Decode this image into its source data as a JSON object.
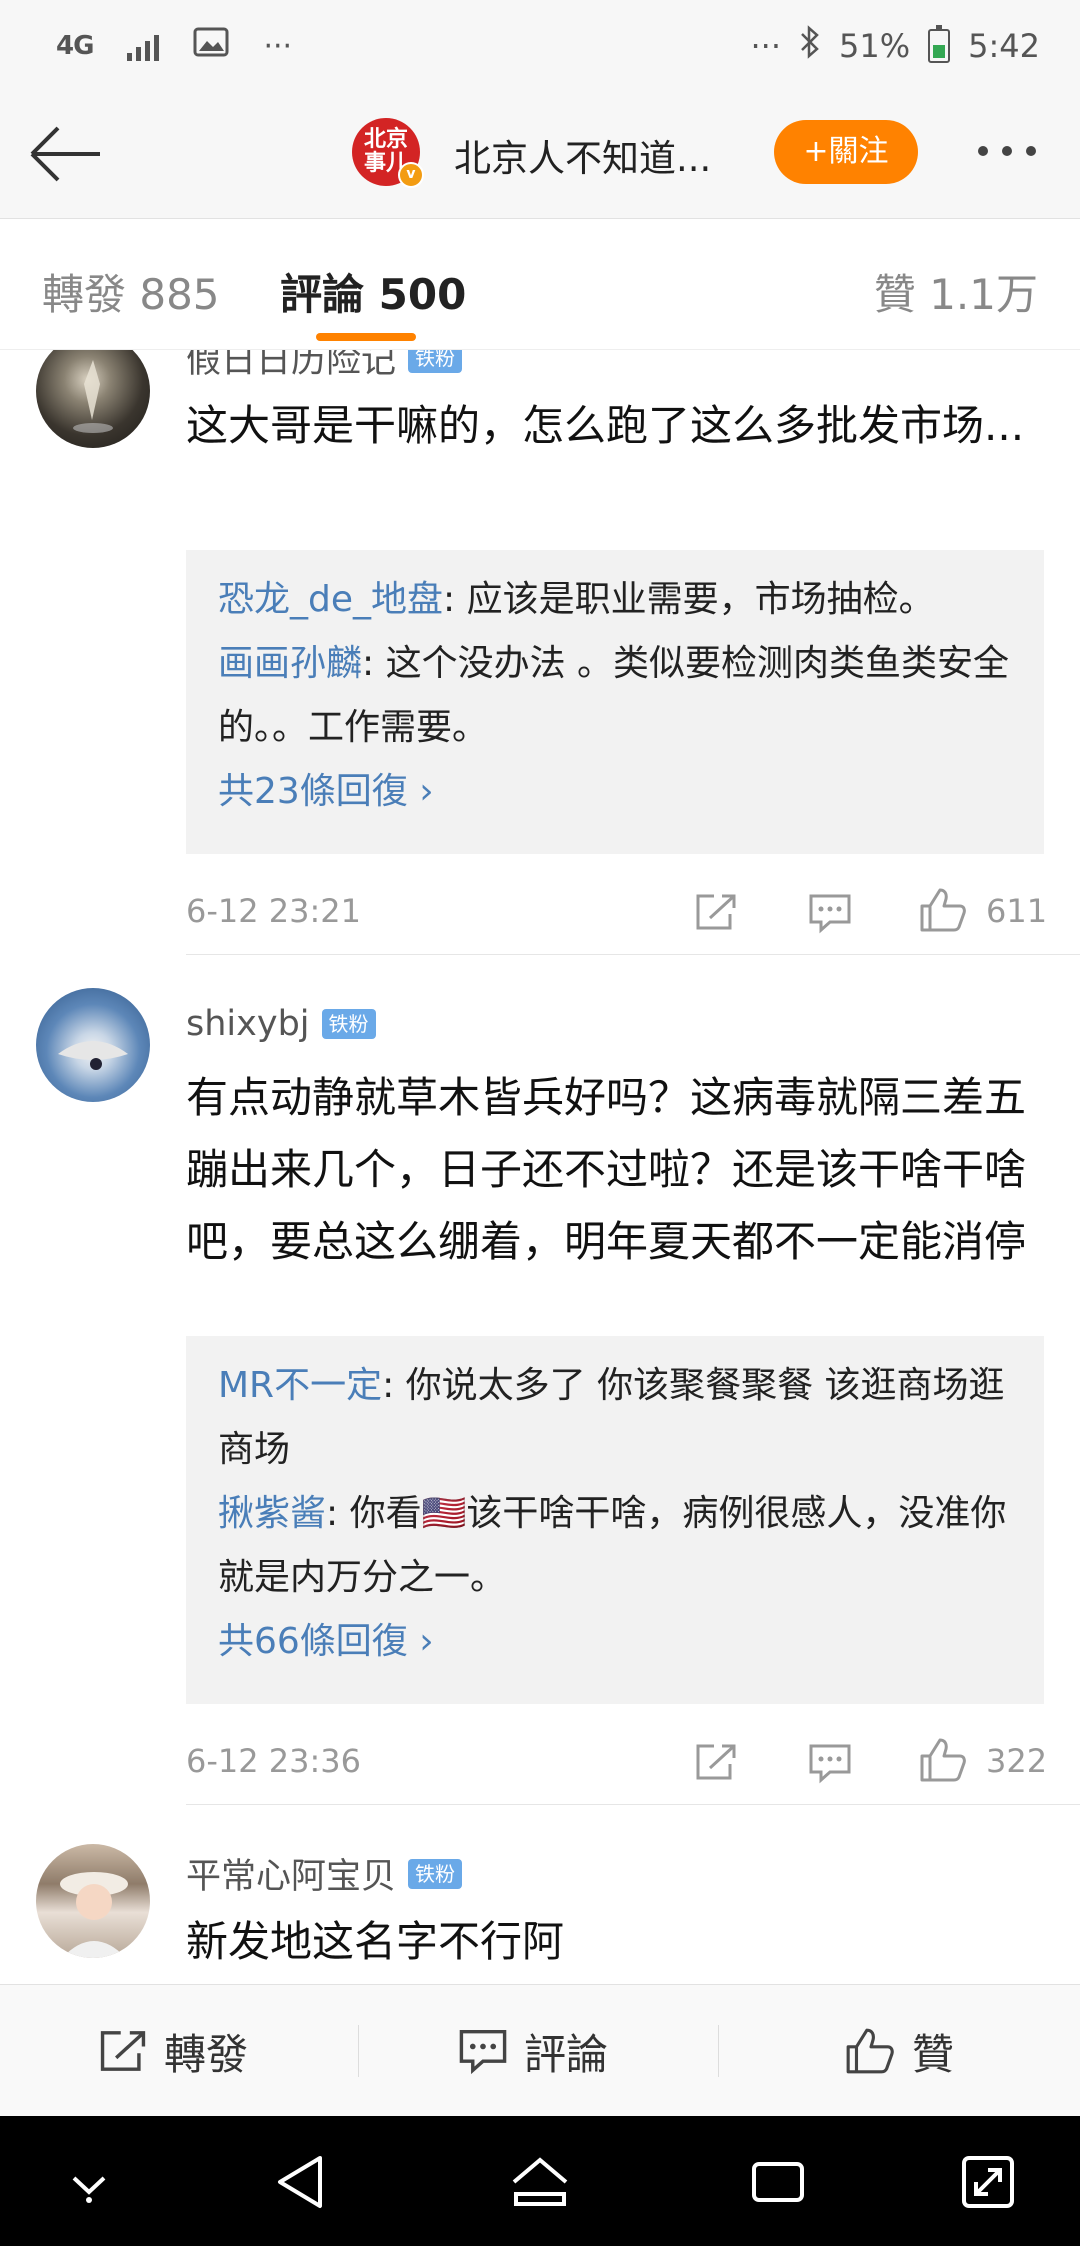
{
  "status_bar": {
    "network": "4G",
    "battery": "51%",
    "time": "5:42",
    "dots_left": "···",
    "dots_right": "···"
  },
  "header": {
    "avatar_text": "北京事儿",
    "title": "北京人不知道...",
    "follow_label": "+關注"
  },
  "tabs": [
    {
      "label": "轉發 885"
    },
    {
      "label": "評論 500"
    },
    {
      "label": "贊 1.1万"
    }
  ],
  "comments": [
    {
      "user": "假日日历险记",
      "badge": "铁粉",
      "text": "这大哥是干嘛的，怎么跑了这么多批发市场...",
      "replies": [
        {
          "name": "恐龙_de_地盘",
          "text": ": 应该是职业需要，市场抽检。"
        },
        {
          "name": "画画孙麟",
          "text": ": 这个没办法 。类似要检测肉类鱼类安全的。。工作需要。"
        }
      ],
      "more_replies": "共23條回復 ›",
      "time": "6-12 23:21",
      "likes": "611"
    },
    {
      "user": "shixybj",
      "badge": "铁粉",
      "text": "有点动静就草木皆兵好吗？这病毒就隔三差五蹦出来几个，日子还不过啦？还是该干啥干啥吧，要总这么绷着，明年夏天都不一定能消停",
      "replies": [
        {
          "name": "MR不一定",
          "text": ": 你说太多了 你该聚餐聚餐 该逛商场逛商场"
        },
        {
          "name": "揪紫酱",
          "text": ": 你看🇺🇸该干啥干啥，病例很感人，没准你就是内万分之一。"
        }
      ],
      "more_replies": "共66條回復 ›",
      "time": "6-12 23:36",
      "likes": "322"
    },
    {
      "user": "平常心阿宝贝",
      "badge": "铁粉",
      "text": "新发地这名字不行阿"
    }
  ],
  "action_bar": {
    "repost": "轉發",
    "comment": "評論",
    "like": "贊"
  },
  "colors": {
    "accent": "#ff8200",
    "link": "#4a7eb8",
    "fan_badge": "#6aa9e8",
    "brand_red": "#d32424"
  },
  "icons": [
    "back-arrow-icon",
    "share-icon",
    "comment-icon",
    "like-icon",
    "nav-down-icon",
    "nav-back-icon",
    "nav-home-icon",
    "nav-recent-icon",
    "nav-expand-icon"
  ]
}
